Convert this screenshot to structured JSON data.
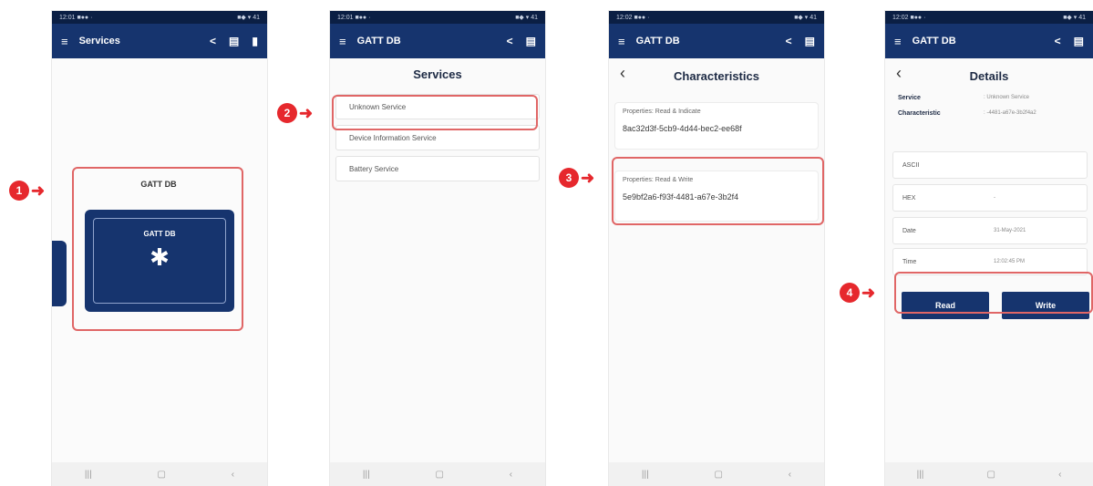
{
  "phone1": {
    "status_left": "12:01 ■●● ·",
    "status_right": "■◆ ▾ 41",
    "appbar_title": "Services",
    "card_title": "GATT DB",
    "device_title": "GATT DB"
  },
  "phone2": {
    "status_left": "12:01 ■●● ·",
    "status_right": "■◆ ▾ 41",
    "appbar_title": "GATT DB",
    "heading": "Services",
    "services": [
      "Unknown Service",
      "Device Information Service",
      "Battery Service"
    ]
  },
  "phone3": {
    "status_left": "12:02 ■●● ·",
    "status_right": "■◆ ▾ 41",
    "appbar_title": "GATT DB",
    "heading": "Characteristics",
    "items": [
      {
        "properties": "Properties:   Read & Indicate",
        "uuid": "8ac32d3f-5cb9-4d44-bec2-ee68f"
      },
      {
        "properties": "Properties:   Read & Write",
        "uuid": "5e9bf2a6-f93f-4481-a67e-3b2f4"
      }
    ]
  },
  "phone4": {
    "status_left": "12:02 ■●● ·",
    "status_right": "■◆ ▾ 41",
    "appbar_title": "GATT DB",
    "heading": "Details",
    "service_label": "Service",
    "service_value": ": Unknown Service",
    "char_label": "Characteristic",
    "char_value": ": -4481-a67e-3b2f4a2",
    "rows": [
      {
        "label": "ASCII",
        "value": ""
      },
      {
        "label": "HEX",
        "value": "-"
      },
      {
        "label": "Date",
        "value": "31-May-2021"
      },
      {
        "label": "Time",
        "value": "12:02:45 PM"
      }
    ],
    "read_label": "Read",
    "write_label": "Write"
  },
  "markers": [
    "1",
    "2",
    "3",
    "4"
  ],
  "nav": {
    "recent": "|||",
    "home": "▢",
    "back": "‹"
  },
  "colors": {
    "appbar": "#16346e",
    "statusbar": "#0b1f44",
    "highlight": "#e06666",
    "marker": "#e6282d"
  }
}
